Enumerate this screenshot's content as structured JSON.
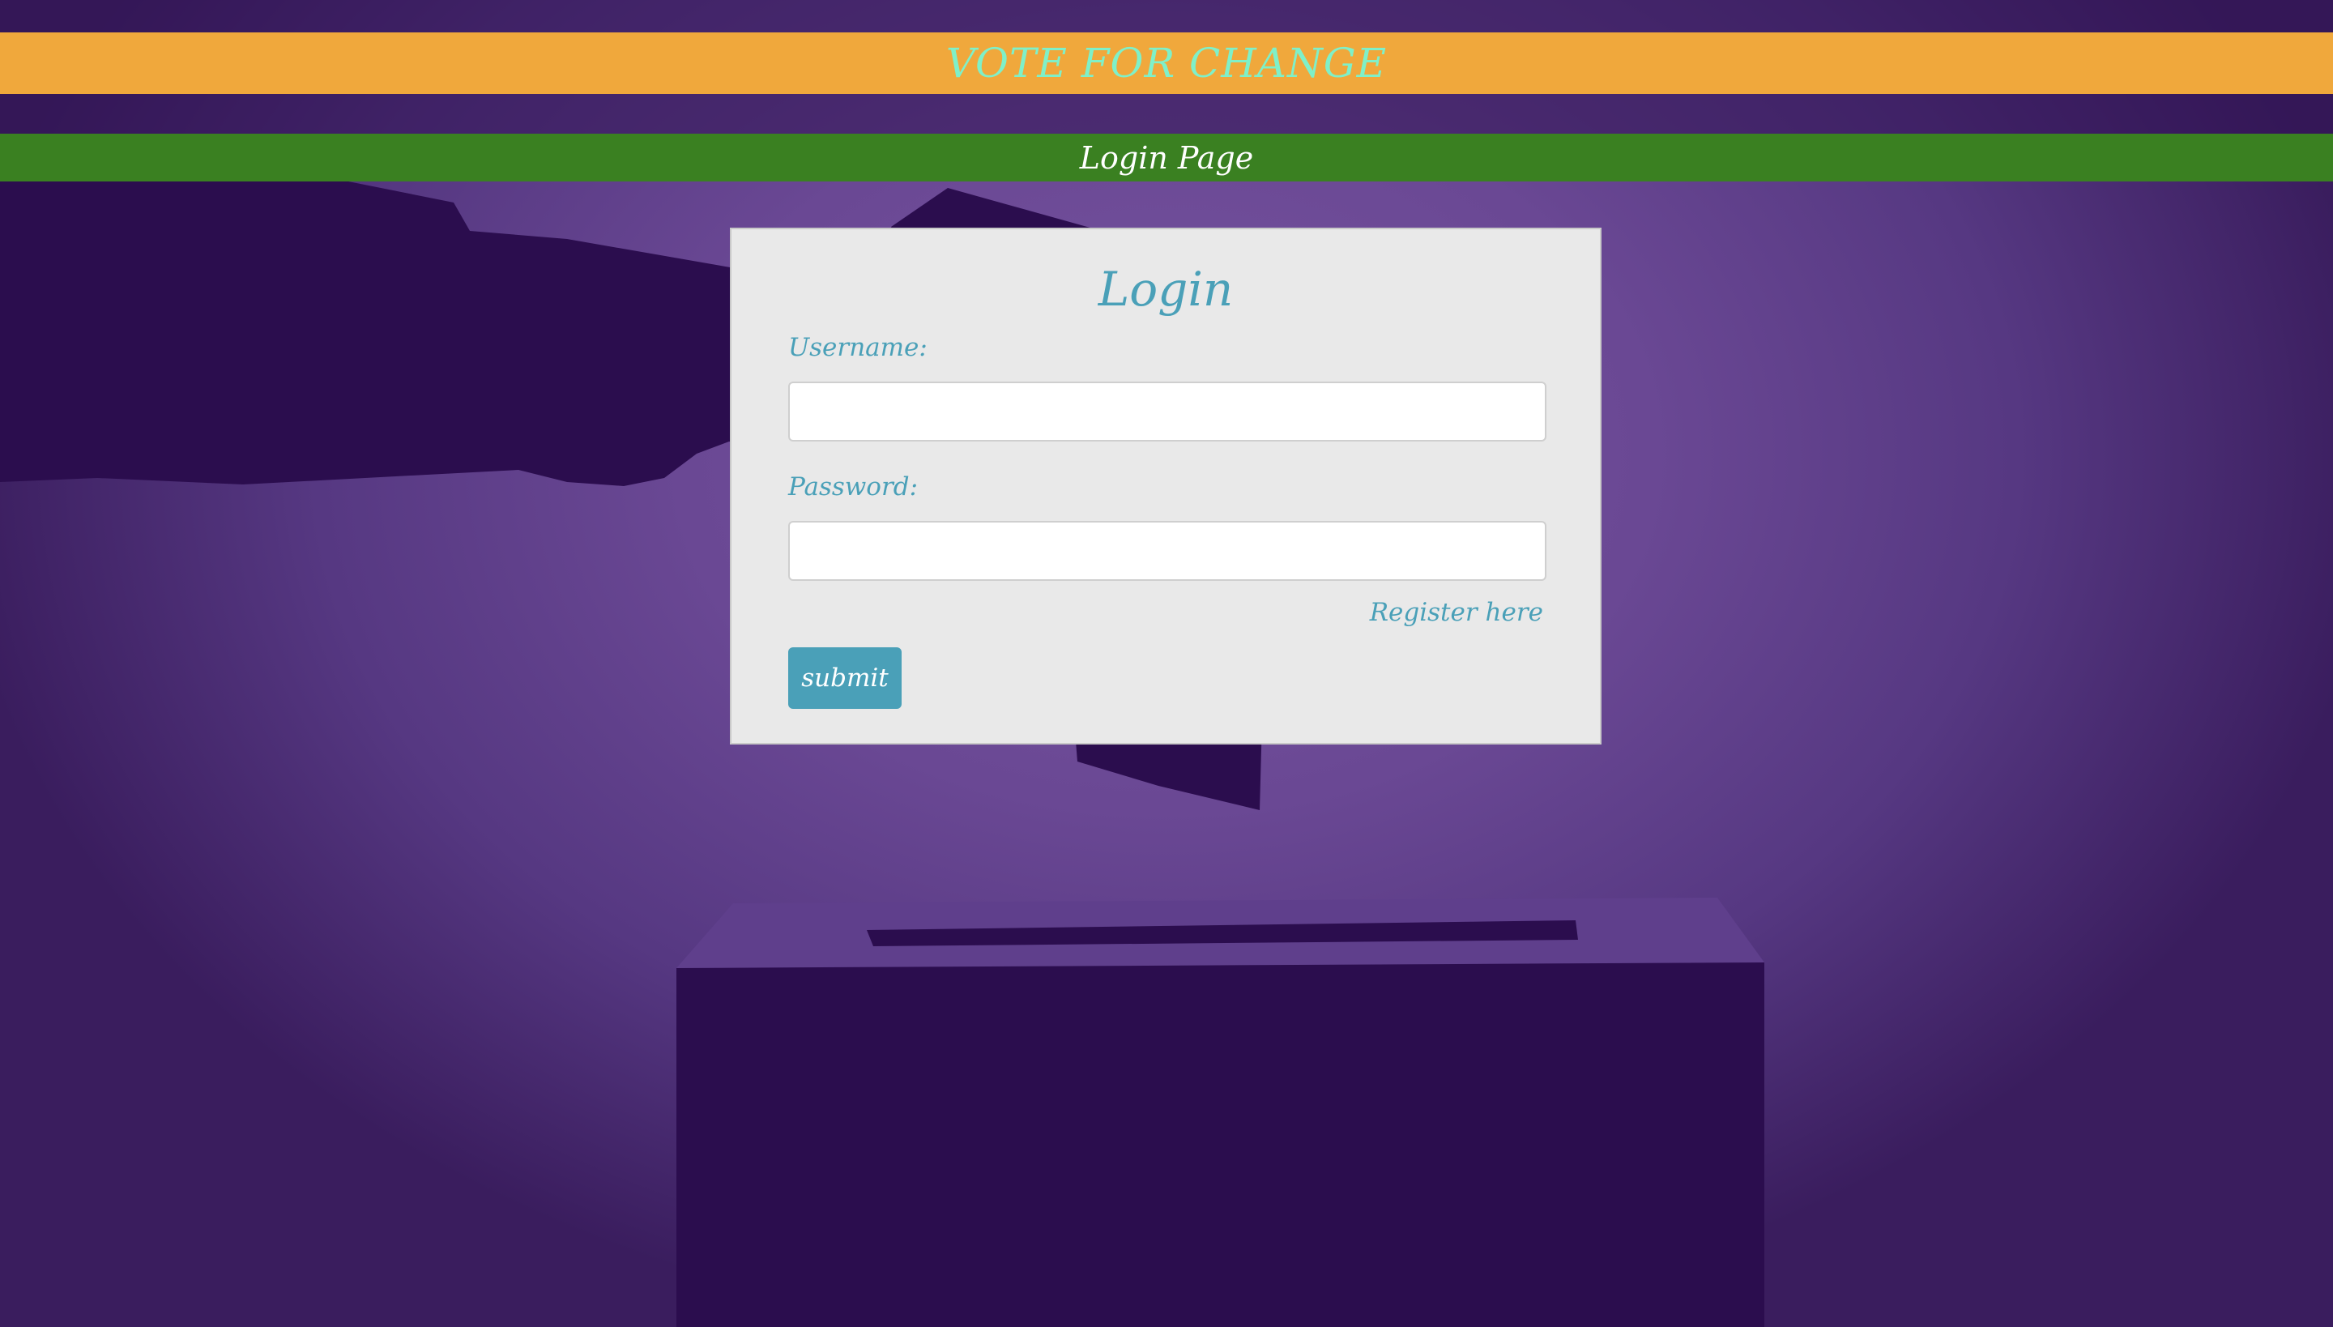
{
  "header": {
    "title": "VOTE FOR CHANGE",
    "subtitle": "Login Page"
  },
  "login": {
    "heading": "Login",
    "username_label": "Username:",
    "username_value": "",
    "password_label": "Password:",
    "password_value": "",
    "register_link": "Register here",
    "submit_label": "submit"
  },
  "colors": {
    "banner_orange": "#f0a83c",
    "banner_green": "#3a8021",
    "title_text": "#7ff0c8",
    "accent": "#4aa0b8",
    "card_bg": "#e9e9e9",
    "silhouette": "#2b0d4e"
  }
}
